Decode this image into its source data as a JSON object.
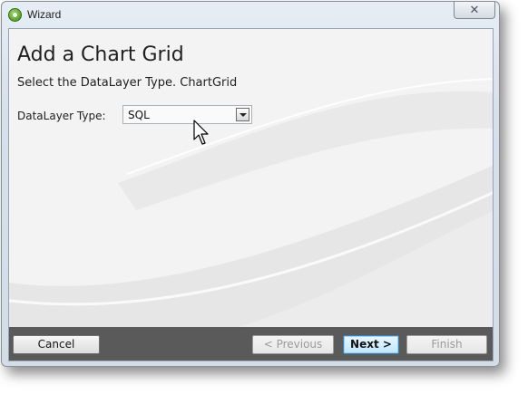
{
  "window": {
    "title": "Wizard",
    "close_glyph": "✕",
    "icon": "wizard-app-icon"
  },
  "page": {
    "heading": "Add a Chart Grid",
    "subheading": "Select the DataLayer Type. ChartGrid"
  },
  "datalayer": {
    "label": "DataLayer Type:",
    "selected": "SQL"
  },
  "footer": {
    "cancel": "Cancel",
    "previous": "< Previous",
    "next": "Next >",
    "finish": "Finish"
  }
}
